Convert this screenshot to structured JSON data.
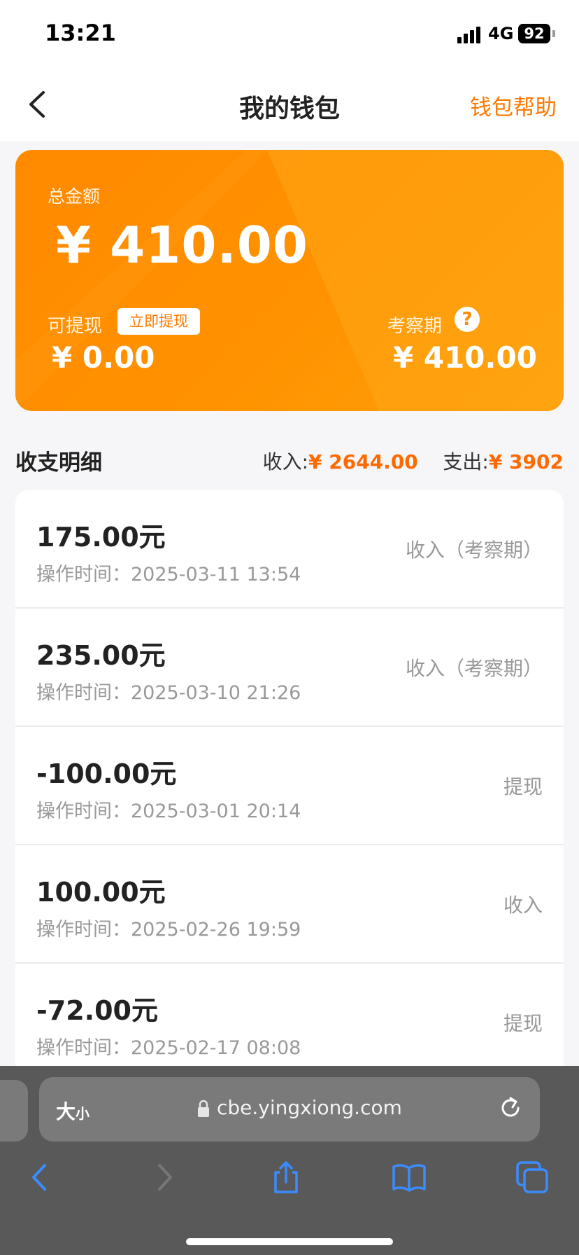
{
  "status": {
    "time": "13:21",
    "network": "4G",
    "battery": "92"
  },
  "nav": {
    "title": "我的钱包",
    "help": "钱包帮助"
  },
  "card": {
    "total_label": "总金额",
    "total": "¥ 410.00",
    "withdrawable_label": "可提现",
    "withdraw_button": "立即提现",
    "withdrawable": "¥ 0.00",
    "probation_label": "考察期",
    "probation": "¥ 410.00",
    "colors": {
      "accent": "#ff8a00",
      "accent_light": "#ffa10a"
    }
  },
  "summary": {
    "title": "收支明细",
    "income_label": "收入:",
    "income": "¥ 2644.00",
    "expense_label": "支出:",
    "expense": "¥ 3902"
  },
  "records": [
    {
      "amount": "175.00元",
      "time": "操作时间：2025-03-11 13:54",
      "type": "收入（考察期）"
    },
    {
      "amount": "235.00元",
      "time": "操作时间：2025-03-10 21:26",
      "type": "收入（考察期）"
    },
    {
      "amount": "-100.00元",
      "time": "操作时间：2025-03-01 20:14",
      "type": "提现"
    },
    {
      "amount": "100.00元",
      "time": "操作时间：2025-02-26 19:59",
      "type": "收入"
    },
    {
      "amount": "-72.00元",
      "time": "操作时间：2025-02-17 08:08",
      "type": "提现"
    }
  ],
  "browser": {
    "text_size_big": "大",
    "text_size_small": "小",
    "url": "cbe.yingxiong.com",
    "icons": [
      "back-icon",
      "forward-icon",
      "share-icon",
      "bookmarks-icon",
      "tabs-icon"
    ]
  }
}
